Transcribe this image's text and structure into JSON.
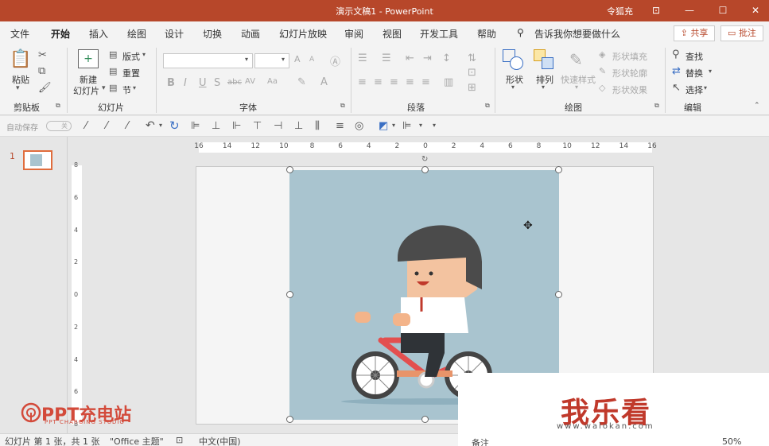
{
  "titlebar": {
    "title": "演示文稿1  -  PowerPoint",
    "user": "令狐充",
    "btn_ribbon_options": "⊡",
    "btn_min": "—",
    "btn_max": "☐",
    "btn_close": "✕"
  },
  "tabs": [
    {
      "label": "文件"
    },
    {
      "label": "开始"
    },
    {
      "label": "插入"
    },
    {
      "label": "绘图"
    },
    {
      "label": "设计"
    },
    {
      "label": "切换"
    },
    {
      "label": "动画"
    },
    {
      "label": "幻灯片放映"
    },
    {
      "label": "审阅"
    },
    {
      "label": "视图"
    },
    {
      "label": "开发工具"
    },
    {
      "label": "帮助"
    }
  ],
  "search": {
    "placeholder": "告诉我你想要做什么"
  },
  "share_label": "共享",
  "comments_label": "批注",
  "ribbon": {
    "clipboard": {
      "paste": "粘贴",
      "group": "剪贴板"
    },
    "slides": {
      "new_slide_line1": "新建",
      "new_slide_line2": "幻灯片",
      "layout": "版式",
      "reset": "重置",
      "section": "节",
      "group": "幻灯片"
    },
    "font": {
      "group": "字体",
      "bold": "B",
      "italic": "I",
      "underline": "U",
      "shadow": "S",
      "strike": "abc",
      "spacing": "AV",
      "case": "Aa",
      "grow": "A",
      "shrink": "A"
    },
    "paragraph": {
      "group": "段落"
    },
    "drawing": {
      "shapes": "形状",
      "arrange": "排列",
      "quick_styles": "快速样式",
      "shape_fill": "形状填充",
      "shape_outline": "形状轮廓",
      "shape_effects": "形状效果",
      "group": "绘图"
    },
    "editing": {
      "find": "查找",
      "replace": "替换",
      "select": "选择",
      "group": "编辑"
    }
  },
  "qat": {
    "autosave": "自动保存",
    "autosave_state": "关"
  },
  "slide_pane": {
    "thumb_number": "1"
  },
  "ruler": {
    "h_ticks": [
      "16",
      "14",
      "12",
      "10",
      "8",
      "6",
      "4",
      "2",
      "0",
      "2",
      "4",
      "6",
      "8",
      "10",
      "12",
      "14",
      "16"
    ],
    "v_ticks": [
      "8",
      "6",
      "4",
      "2",
      "0",
      "2",
      "4",
      "6",
      "8"
    ]
  },
  "status": {
    "slide_info": "幻灯片 第 1 张，共 1 张",
    "theme": "\"Office 主题\"",
    "language": "中文(中国)",
    "notes": "备注",
    "zoom": "50%"
  },
  "overlay": {
    "logo_text": "PPT充电站",
    "logo_sub": "PPT CHARGING STUDIO",
    "wm_text": "我乐看",
    "wm_url": "www.walokan.com"
  },
  "colors": {
    "accent": "#b7472a",
    "picture_bg": "#a9c4cf"
  }
}
